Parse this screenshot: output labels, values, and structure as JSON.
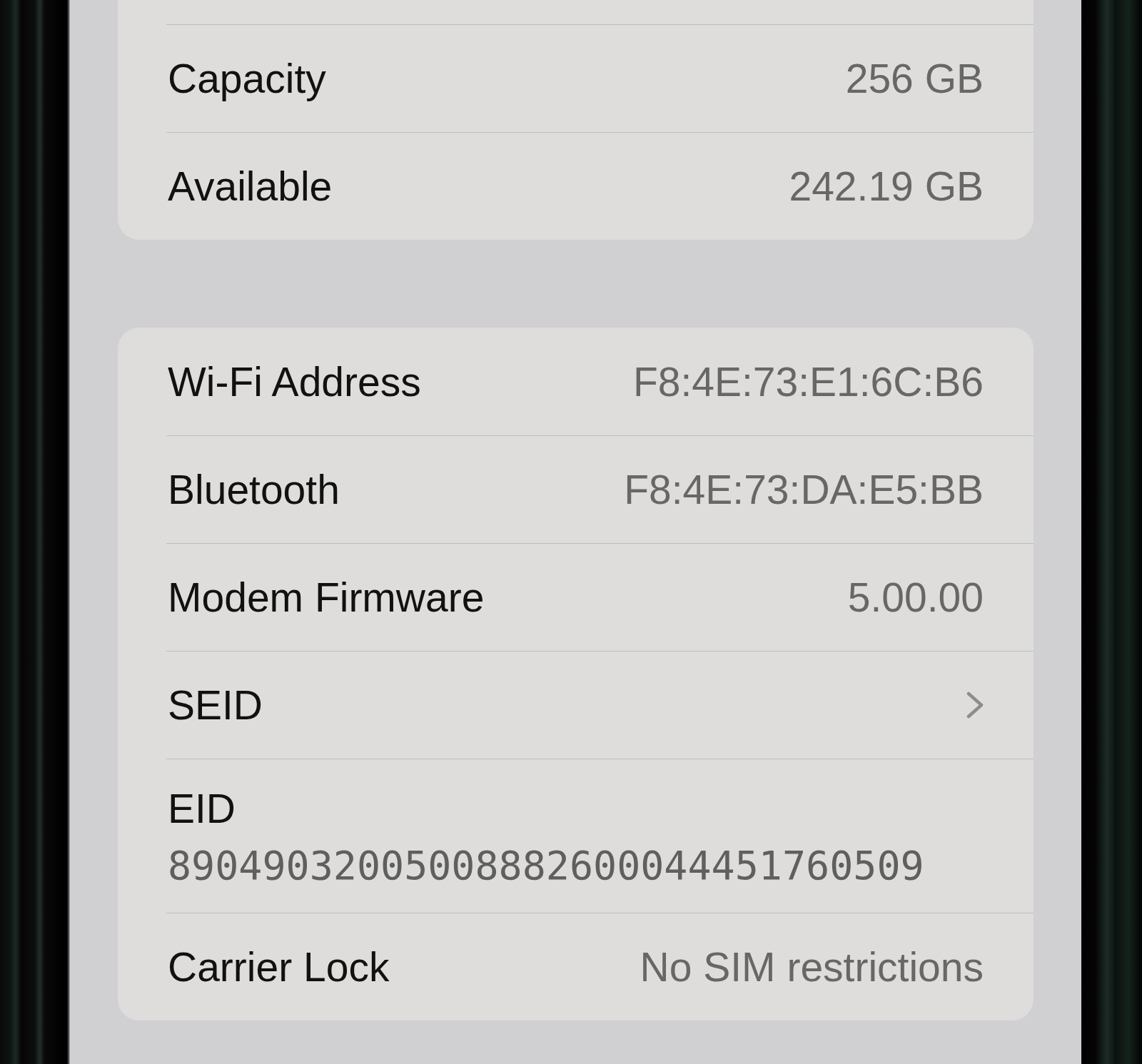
{
  "sections": [
    {
      "clipped_top": true,
      "rows": [
        {
          "kind": "value",
          "label": "Capacity",
          "value": "256 GB"
        },
        {
          "kind": "value",
          "label": "Available",
          "value": "242.19 GB"
        }
      ]
    },
    {
      "clipped_top": false,
      "rows": [
        {
          "kind": "value",
          "label": "Wi-Fi Address",
          "value": "F8:4E:73:E1:6C:B6"
        },
        {
          "kind": "value",
          "label": "Bluetooth",
          "value": "F8:4E:73:DA:E5:BB"
        },
        {
          "kind": "value",
          "label": "Modem Firmware",
          "value": "5.00.00"
        },
        {
          "kind": "link",
          "label": "SEID"
        },
        {
          "kind": "stacked",
          "label": "EID",
          "value": "89049032005008882600044451760509"
        },
        {
          "kind": "value",
          "label": "Carrier Lock",
          "value": "No SIM restrictions"
        }
      ]
    }
  ]
}
